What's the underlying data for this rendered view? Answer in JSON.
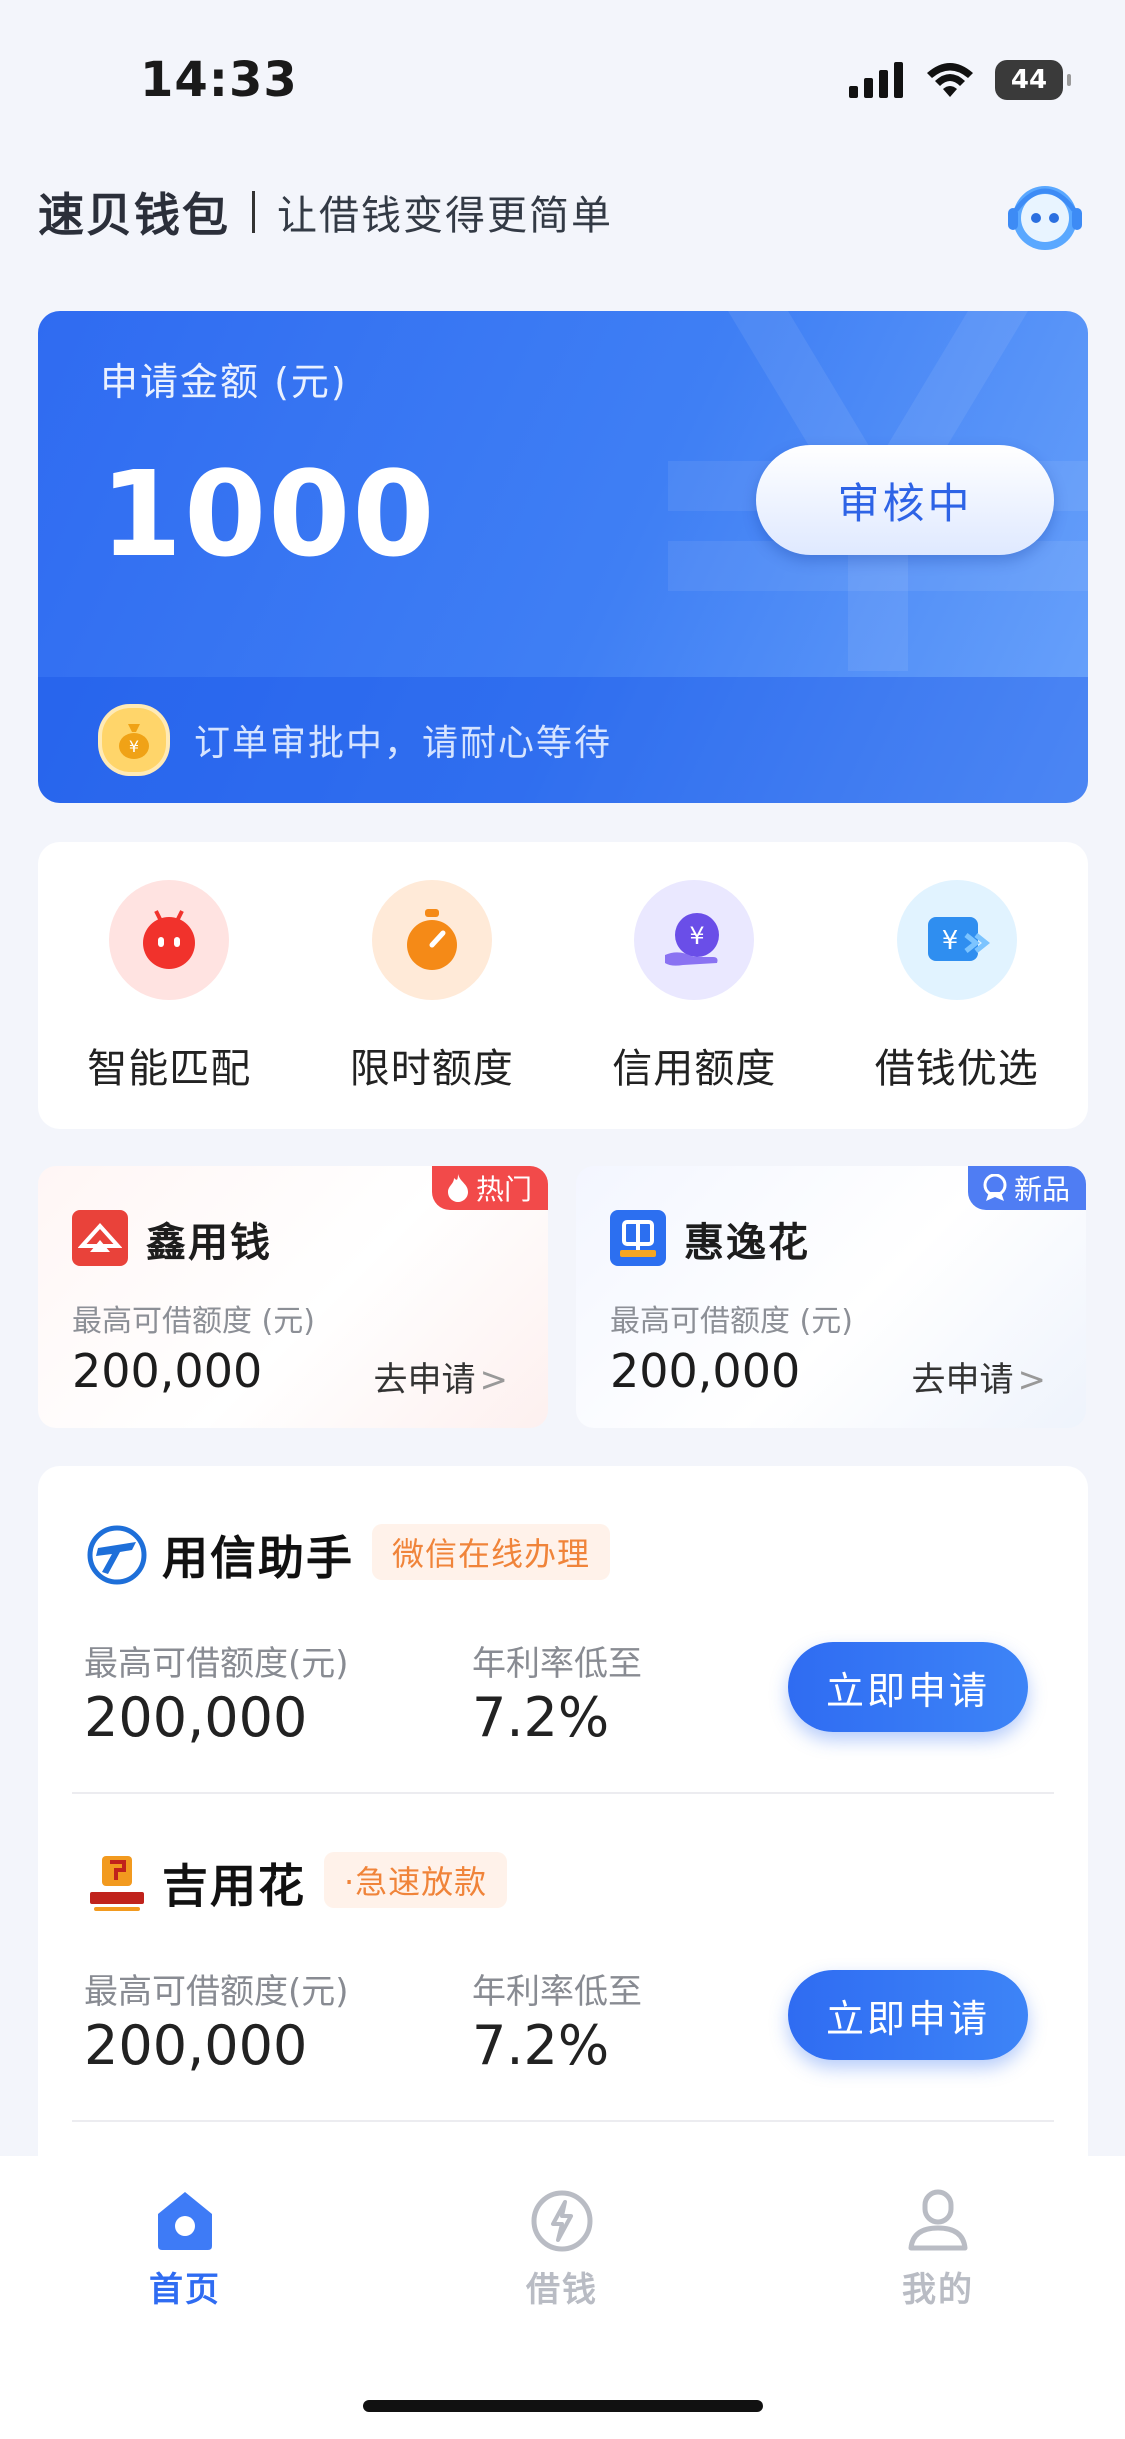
{
  "status_bar": {
    "time": "14:33",
    "battery": "44"
  },
  "header": {
    "brand": "速贝钱包",
    "slogan": "让借钱变得更简单"
  },
  "hero": {
    "label": "申请金额 (元)",
    "amount": "1000",
    "status_button": "审核中",
    "notice": "订单审批中，请耐心等待"
  },
  "quick_actions": [
    {
      "label": "智能匹配",
      "icon": "robot-icon",
      "bg": "#ffe3e1",
      "color": "#f1322c"
    },
    {
      "label": "限时额度",
      "icon": "stopwatch-icon",
      "bg": "#ffead8",
      "color": "#f58a17"
    },
    {
      "label": "信用额度",
      "icon": "yuan-hand-icon",
      "bg": "#eae8ff",
      "color": "#6a4ee8"
    },
    {
      "label": "借钱优选",
      "icon": "yuan-transfer-icon",
      "bg": "#e1f3ff",
      "color": "#2f8ef0"
    }
  ],
  "promos": [
    {
      "tag": "热门",
      "tag_icon": "flame-icon",
      "name": "鑫用钱",
      "sub": "最高可借额度 (元)",
      "amount": "200,000",
      "link": "去申请",
      "chevron": ">"
    },
    {
      "tag": "新品",
      "tag_icon": "badge-icon",
      "name": "惠逸花",
      "sub": "最高可借额度 (元)",
      "amount": "200,000",
      "link": "去申请",
      "chevron": ">"
    }
  ],
  "products": [
    {
      "name": "用信助手",
      "tag": "微信在线办理",
      "label1": "最高可借额度(元)",
      "value1": "200,000",
      "label2": "年利率低至",
      "value2": "7.2%",
      "button": "立即申请"
    },
    {
      "name": "吉用花",
      "tag": "·急速放款",
      "label1": "最高可借额度(元)",
      "value1": "200,000",
      "label2": "年利率低至",
      "value2": "7.2%",
      "button": "立即申请"
    }
  ],
  "tabs": [
    {
      "label": "首页",
      "icon": "home-icon",
      "active": true
    },
    {
      "label": "借钱",
      "icon": "lightning-icon",
      "active": false
    },
    {
      "label": "我的",
      "icon": "user-icon",
      "active": false
    }
  ],
  "colors": {
    "accent": "#2f6cf2",
    "tab_inactive": "#b9bcc4",
    "tag_orange": "#f0843a",
    "hot_red": "#f24a4a"
  }
}
